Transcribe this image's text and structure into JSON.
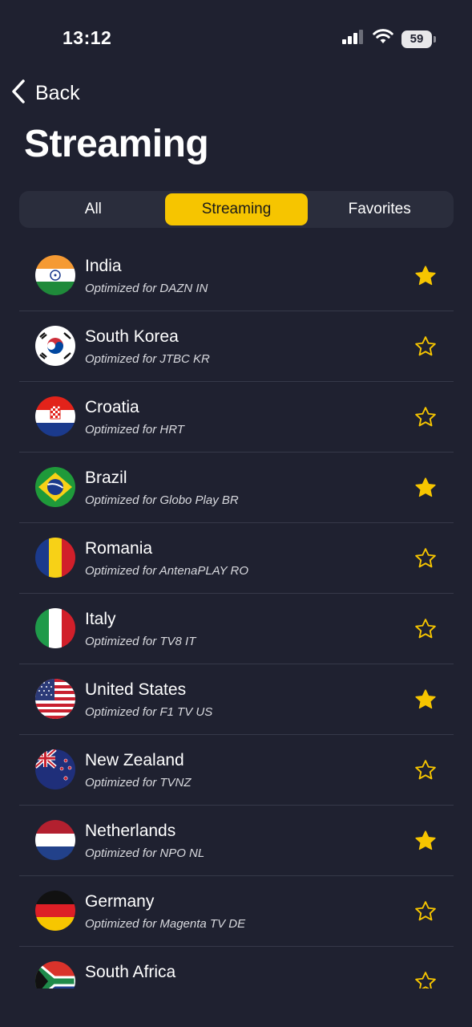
{
  "status_bar": {
    "time": "13:12",
    "battery": "59"
  },
  "nav": {
    "back_label": "Back"
  },
  "page_title": "Streaming",
  "tabs": [
    {
      "label": "All",
      "active": false
    },
    {
      "label": "Streaming",
      "active": true
    },
    {
      "label": "Favorites",
      "active": false
    }
  ],
  "colors": {
    "accent": "#f6c500",
    "background": "#1f2130",
    "segment_bg": "#2a2d3c"
  },
  "countries": [
    {
      "name": "India",
      "subtitle": "Optimized for DAZN IN",
      "flag": "india-flag-icon",
      "favorite": true
    },
    {
      "name": "South Korea",
      "subtitle": "Optimized for JTBC KR",
      "flag": "south-korea-flag-icon",
      "favorite": false
    },
    {
      "name": "Croatia",
      "subtitle": "Optimized for HRT",
      "flag": "croatia-flag-icon",
      "favorite": false
    },
    {
      "name": "Brazil",
      "subtitle": "Optimized for Globo Play BR",
      "flag": "brazil-flag-icon",
      "favorite": true
    },
    {
      "name": "Romania",
      "subtitle": "Optimized for AntenaPLAY RO",
      "flag": "romania-flag-icon",
      "favorite": false
    },
    {
      "name": "Italy",
      "subtitle": "Optimized for TV8 IT",
      "flag": "italy-flag-icon",
      "favorite": false
    },
    {
      "name": "United States",
      "subtitle": "Optimized for F1 TV US",
      "flag": "united-states-flag-icon",
      "favorite": true
    },
    {
      "name": "New Zealand",
      "subtitle": "Optimized for TVNZ",
      "flag": "new-zealand-flag-icon",
      "favorite": false
    },
    {
      "name": "Netherlands",
      "subtitle": "Optimized for NPO NL",
      "flag": "netherlands-flag-icon",
      "favorite": true
    },
    {
      "name": "Germany",
      "subtitle": "Optimized for Magenta TV DE",
      "flag": "germany-flag-icon",
      "favorite": false
    },
    {
      "name": "South Africa",
      "subtitle": "",
      "flag": "south-africa-flag-icon",
      "favorite": false
    }
  ]
}
